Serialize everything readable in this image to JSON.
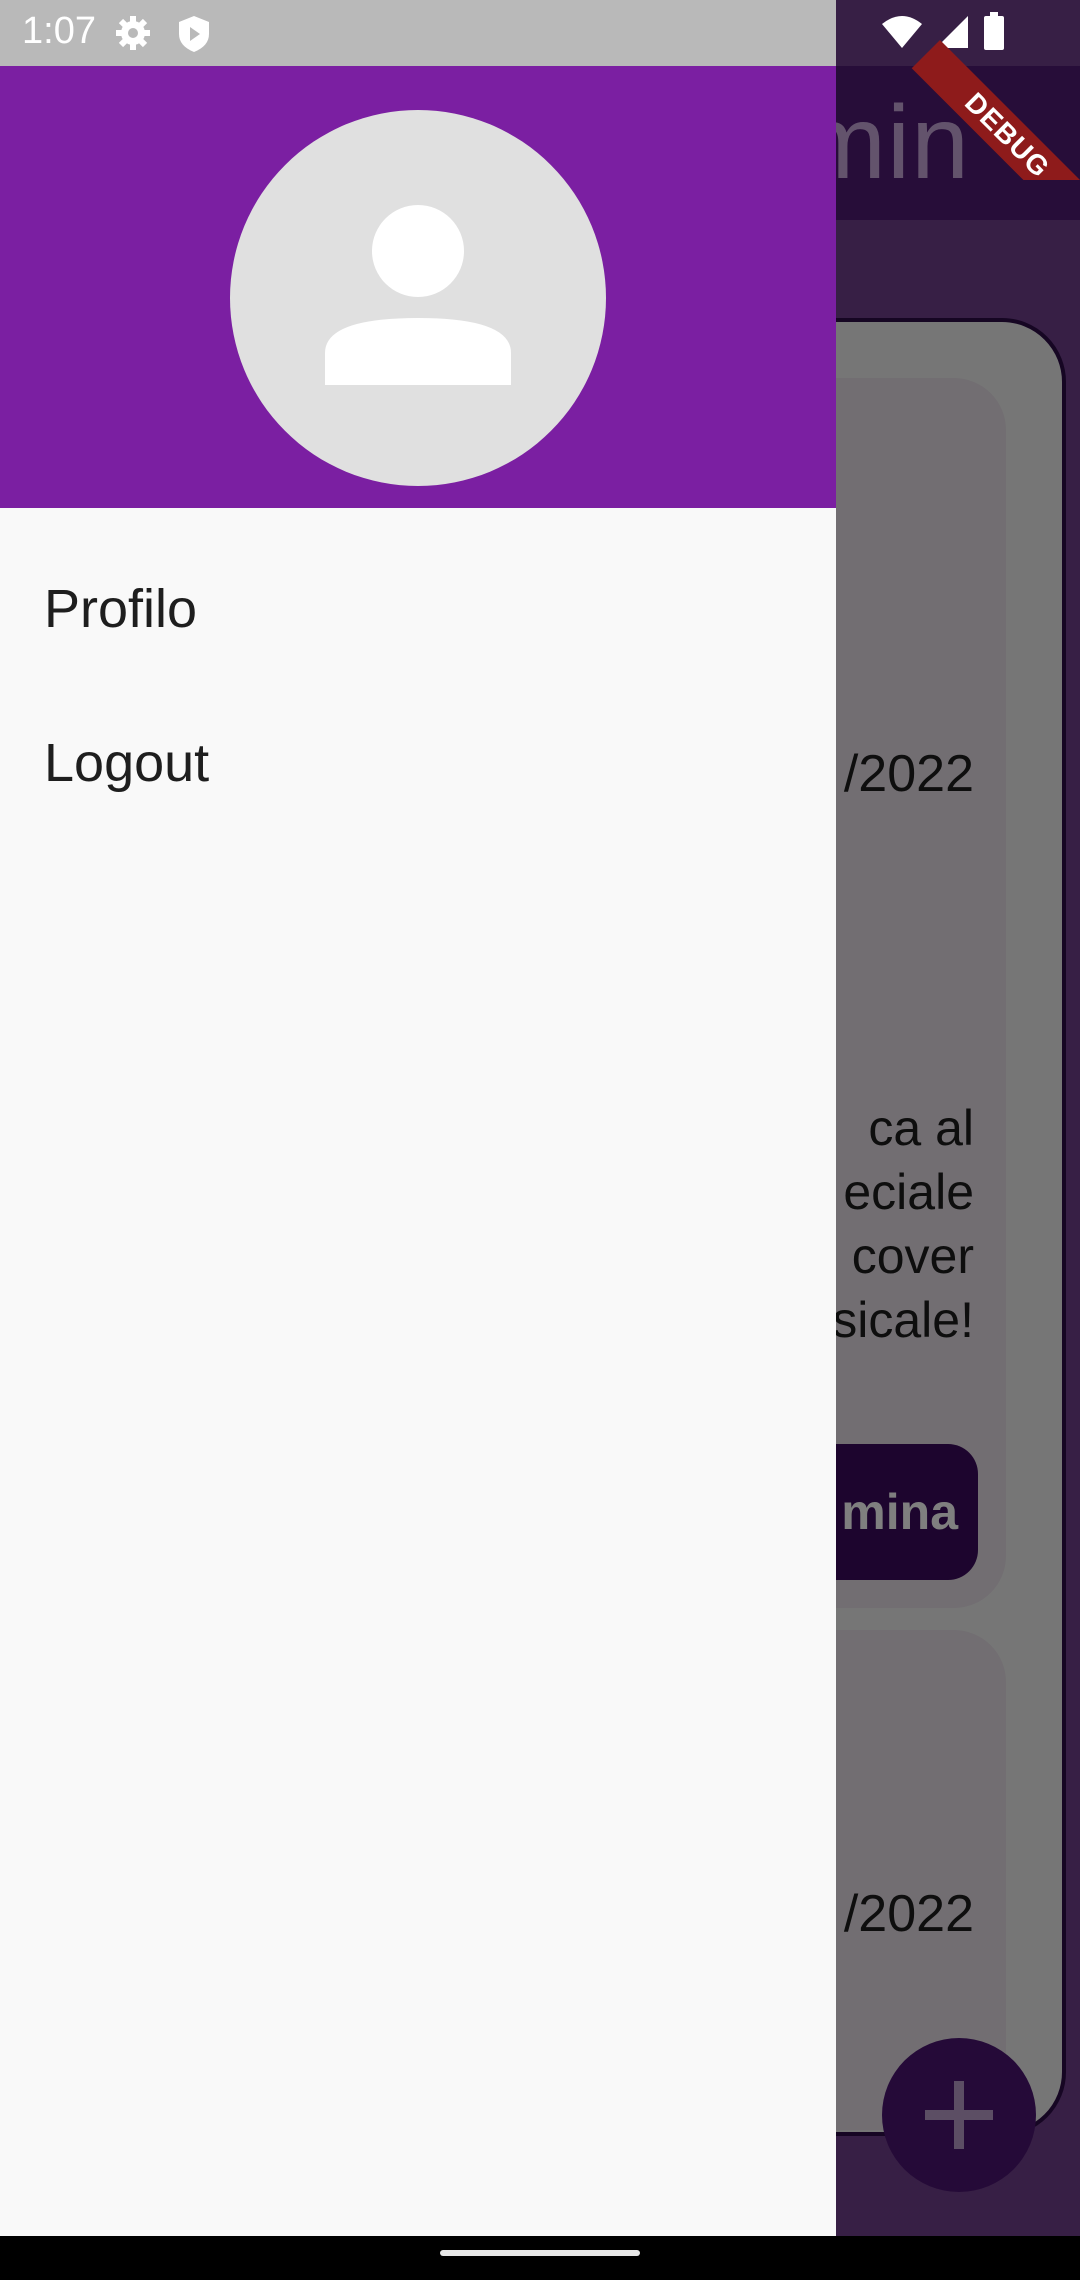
{
  "status_bar": {
    "time": "1:07",
    "icons": [
      "gear-icon",
      "shield-icon",
      "wifi-icon",
      "signal-icon",
      "battery-icon"
    ],
    "debug_label": "DEBUG"
  },
  "app_bar": {
    "title_partial": "min"
  },
  "background": {
    "event_1": {
      "date_partial": "/2022",
      "description_lines": [
        "ca al",
        "eciale",
        "cover",
        "sicale!"
      ],
      "delete_button_partial": "mina"
    },
    "event_2": {
      "date_partial": "/2022"
    },
    "fab_icon": "plus-icon"
  },
  "drawer": {
    "avatar_icon": "person-icon",
    "items": [
      {
        "label": "Profilo"
      },
      {
        "label": "Logout"
      }
    ]
  },
  "colors": {
    "drawer_header": "#7b1fa2",
    "drawer_bg": "#f9f9f9",
    "primary_dark": "#3a0a5c",
    "debug_ribbon": "#8e1b1b"
  }
}
